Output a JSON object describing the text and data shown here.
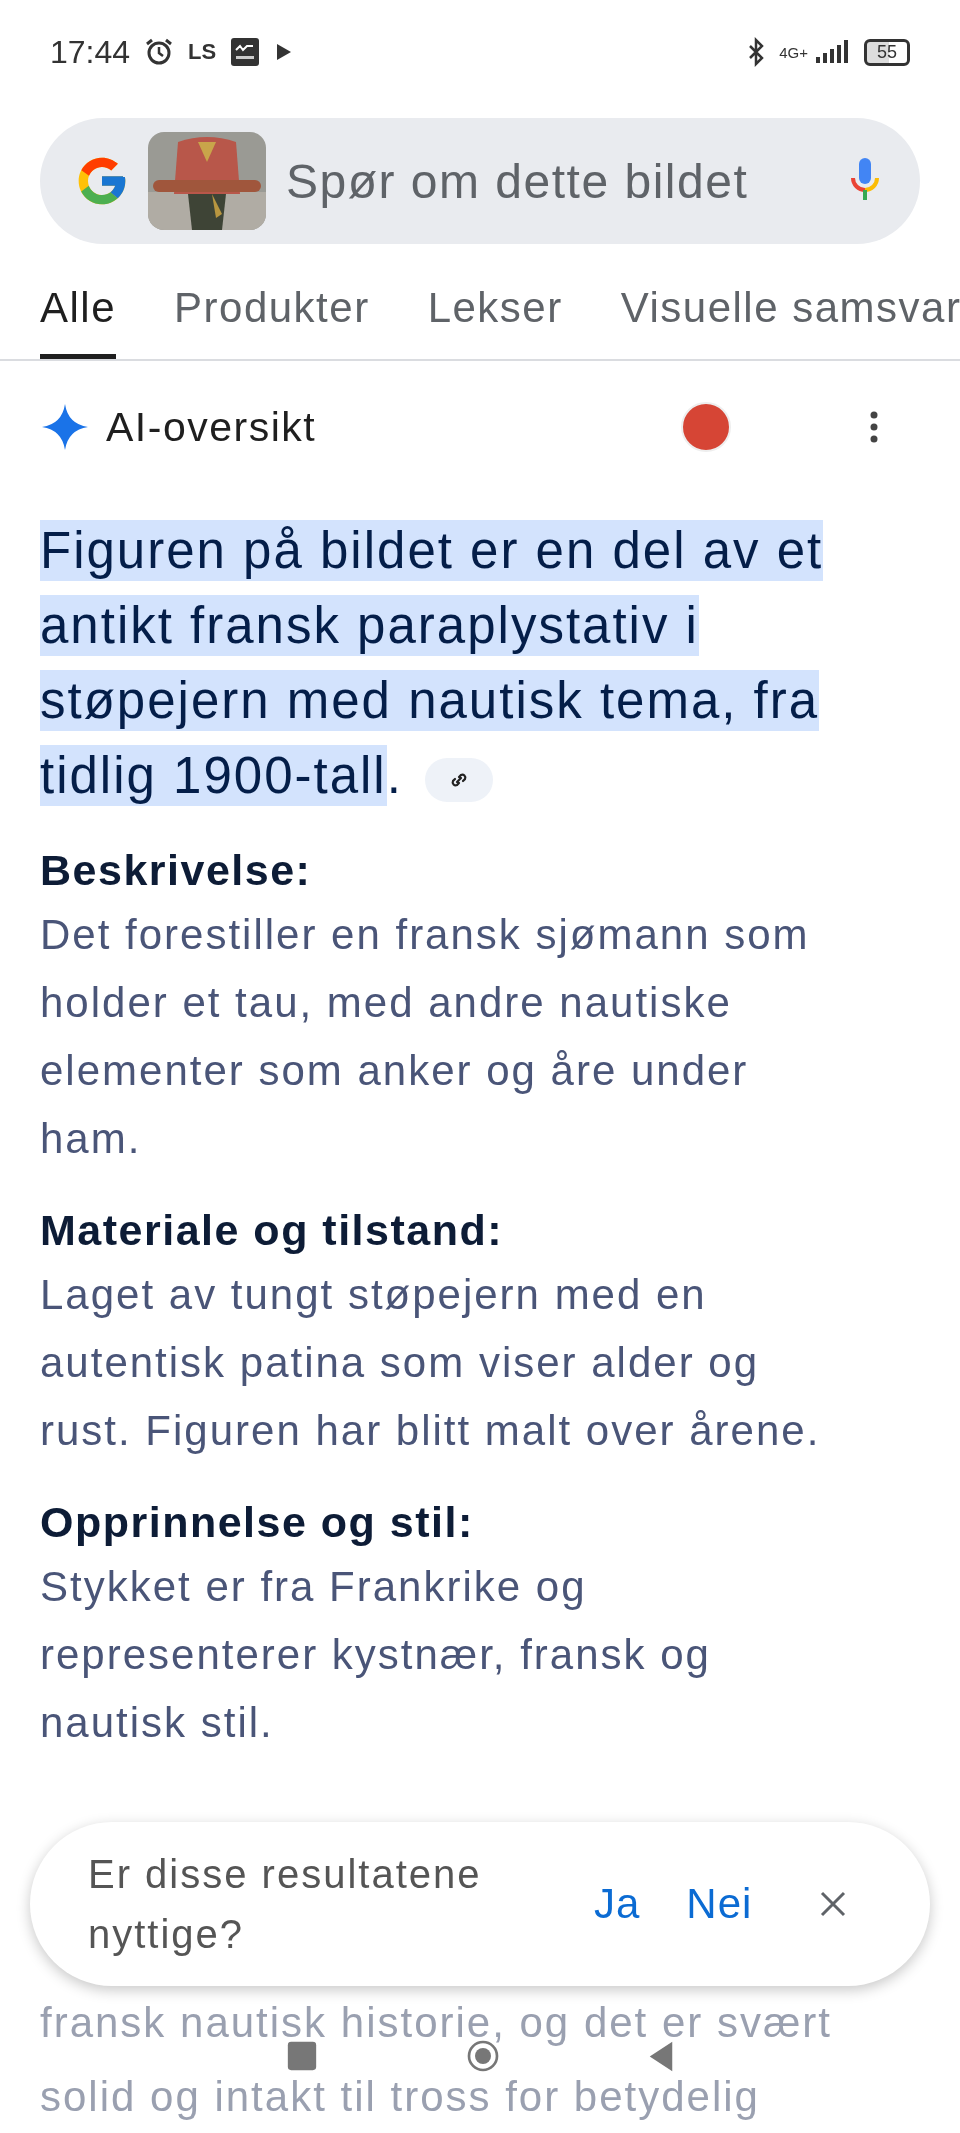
{
  "status_bar": {
    "time": "17:44",
    "app_label": "LS",
    "network": "4G+",
    "battery": "55"
  },
  "search": {
    "placeholder": "Spør om dette bildet"
  },
  "tabs": [
    {
      "label": "Alle",
      "selected": true
    },
    {
      "label": "Produkter",
      "selected": false
    },
    {
      "label": "Lekser",
      "selected": false
    },
    {
      "label": "Visuelle samsvar",
      "selected": false
    }
  ],
  "ai_overview": {
    "title": "AI-oversikt",
    "summary": "Figuren på bildet er en del av et antikt fransk paraplystativ i støpejern med nautisk tema, fra tidlig 1900-tall",
    "summary_end": ".",
    "sections": [
      {
        "heading": "Beskrivelse:",
        "text": "Det forestiller en fransk sjømann som holder et tau, med andre nautiske elementer som anker og åre under ham."
      },
      {
        "heading": "Materiale og tilstand:",
        "text": "Laget av tungt støpejern med en autentisk patina som viser alder og rust. Figuren har blitt malt over årene."
      },
      {
        "heading": "Opprinnelse og stil:",
        "text": "Stykket er fra Frankrike og representerer kystnær, fransk og nautisk stil."
      }
    ],
    "faded_lines": [
      "fransk nautisk historie, og det er svært",
      "solid og intakt til tross for betydelig"
    ]
  },
  "feedback": {
    "question": "Er disse resultatene nyttige?",
    "buttons": [
      "Ja",
      "Nei"
    ]
  }
}
